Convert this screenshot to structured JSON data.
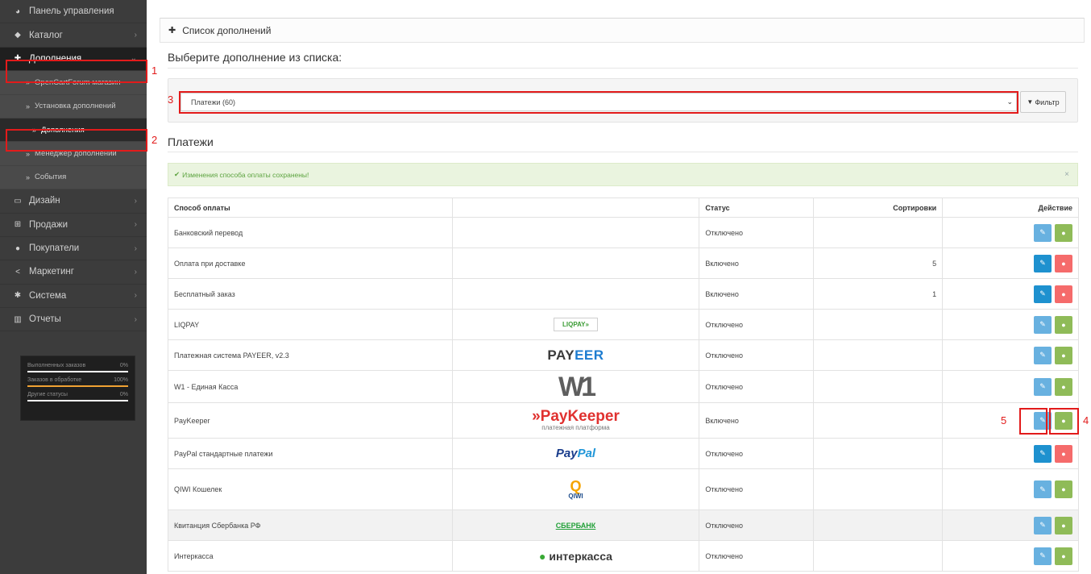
{
  "sidebar": {
    "items": [
      {
        "label": "Панель управления",
        "icon": "dashboard-icon"
      },
      {
        "label": "Каталог",
        "icon": "tag-icon"
      },
      {
        "label": "Дополнения",
        "icon": "puzzle-icon"
      },
      {
        "label": "Дизайн",
        "icon": "monitor-icon"
      },
      {
        "label": "Продажи",
        "icon": "cart-icon"
      },
      {
        "label": "Покупатели",
        "icon": "user-icon"
      },
      {
        "label": "Маркетинг",
        "icon": "share-icon"
      },
      {
        "label": "Система",
        "icon": "gear-icon"
      },
      {
        "label": "Отчеты",
        "icon": "bar-chart-icon"
      }
    ],
    "sub_items": [
      {
        "label": "OpenCartForum магазин"
      },
      {
        "label": "Установка дополнений"
      },
      {
        "label": "Дополнения"
      },
      {
        "label": "Менеджер дополнений"
      },
      {
        "label": "События"
      }
    ],
    "stats": [
      {
        "label": "Выполненных заказов",
        "value": "0%",
        "fraction": 0
      },
      {
        "label": "Заказов в обработке",
        "value": "100%",
        "fraction": 1
      },
      {
        "label": "Другие статусы",
        "value": "0%",
        "fraction": 0
      }
    ]
  },
  "annotations": {
    "a1": "1",
    "a2": "2",
    "a3": "3",
    "a4": "4",
    "a5": "5"
  },
  "panel": {
    "heading": "Список дополнений",
    "select_title": "Выберите дополнение из списка:",
    "select_value": "Платежи (60)",
    "filter_label": "Фильтр",
    "section_title": "Платежи",
    "alert": "Изменения способа оплаты сохранены!",
    "alert_close": "×"
  },
  "table": {
    "headers": {
      "method": "Способ оплаты",
      "status": "Статус",
      "sort": "Сортировки",
      "action": "Действие"
    },
    "rows": [
      {
        "name": "Банковский перевод",
        "logo_text": "",
        "status": "Отключено",
        "sort": "",
        "installed": false
      },
      {
        "name": "Оплата при доставке",
        "logo_text": "",
        "status": "Включено",
        "sort": "5",
        "installed": true
      },
      {
        "name": "Бесплатный заказ",
        "logo_text": "",
        "status": "Включено",
        "sort": "1",
        "installed": true
      },
      {
        "name": "LIQPAY",
        "logo_text": "LIQPAY»",
        "status": "Отключено",
        "sort": "",
        "installed": false
      },
      {
        "name": "Платежная система PAYEER, v2.3",
        "logo_text": "PAYEER",
        "status": "Отключено",
        "sort": "",
        "installed": false
      },
      {
        "name": "W1 - Единая Касса",
        "logo_text": "W1",
        "status": "Отключено",
        "sort": "",
        "installed": false
      },
      {
        "name": "PayKeeper",
        "logo_text": "PayKeeper",
        "logo_sub": "платежная платформа",
        "status": "Включено",
        "sort": "",
        "installed": false
      },
      {
        "name": "PayPal стандартные платежи",
        "logo_text": "PayPal",
        "status": "Отключено",
        "sort": "",
        "installed": true
      },
      {
        "name": "QIWI Кошелек",
        "logo_text": "QIWI",
        "status": "Отключено",
        "sort": "",
        "installed": false
      },
      {
        "name": "Квитанция Сбербанка РФ",
        "logo_text": "СБЕРБАНК",
        "status": "Отключено",
        "sort": "",
        "installed": false
      },
      {
        "name": "Интеркасса",
        "logo_text": "интеркасса",
        "status": "Отключено",
        "sort": "",
        "installed": false
      }
    ]
  },
  "colors": {
    "sidebar_bg": "#3c3c3c",
    "edit_light": "#68b1e0",
    "edit_dark": "#1e91cf",
    "install": "#8fbb58",
    "uninstall": "#f56b6b",
    "annotation": "#e21b1b"
  }
}
